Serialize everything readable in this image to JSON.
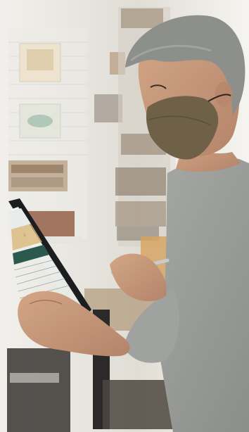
{
  "photo": {
    "colors": {
      "background": "#e4e2dc",
      "shirt": "#9a9c99",
      "skin": "#c79a7a",
      "hair": "#8d8f8b",
      "mask": "#6f6147",
      "tablet_frame": "#1b1d1f",
      "tablet_screen": "#f3f5f2",
      "tablet_accent": "#2a5a4e",
      "stylus": "#c9cbcc",
      "shelf_wood": "#a3855f"
    }
  }
}
